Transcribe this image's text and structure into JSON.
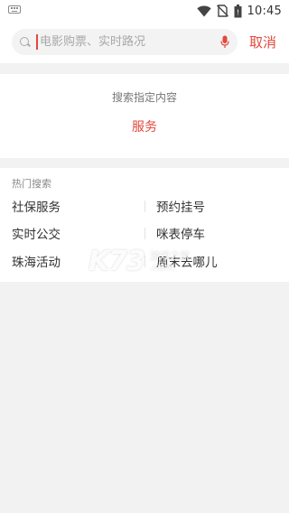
{
  "status_bar": {
    "time": "10:45",
    "icons": [
      "keyboard-icon",
      "wifi-icon",
      "no-sim-icon",
      "battery-icon"
    ]
  },
  "search": {
    "placeholder": "电影购票、实时路况",
    "value": "",
    "cancel_label": "取消",
    "icons": [
      "search-icon",
      "mic-icon"
    ]
  },
  "scope": {
    "title": "搜索指定内容",
    "option": "服务"
  },
  "hot_search": {
    "title": "热门搜索",
    "items": [
      "社保服务",
      "预约挂号",
      "实时公交",
      "咪表停车",
      "珠海活动",
      "周末去哪儿"
    ]
  },
  "watermark": {
    "logo": "K73",
    "line1": "游戏之家",
    "line2": ".com"
  },
  "colors": {
    "accent": "#e2483c",
    "background": "#f2f2f2",
    "placeholder": "#a8a8a8"
  }
}
